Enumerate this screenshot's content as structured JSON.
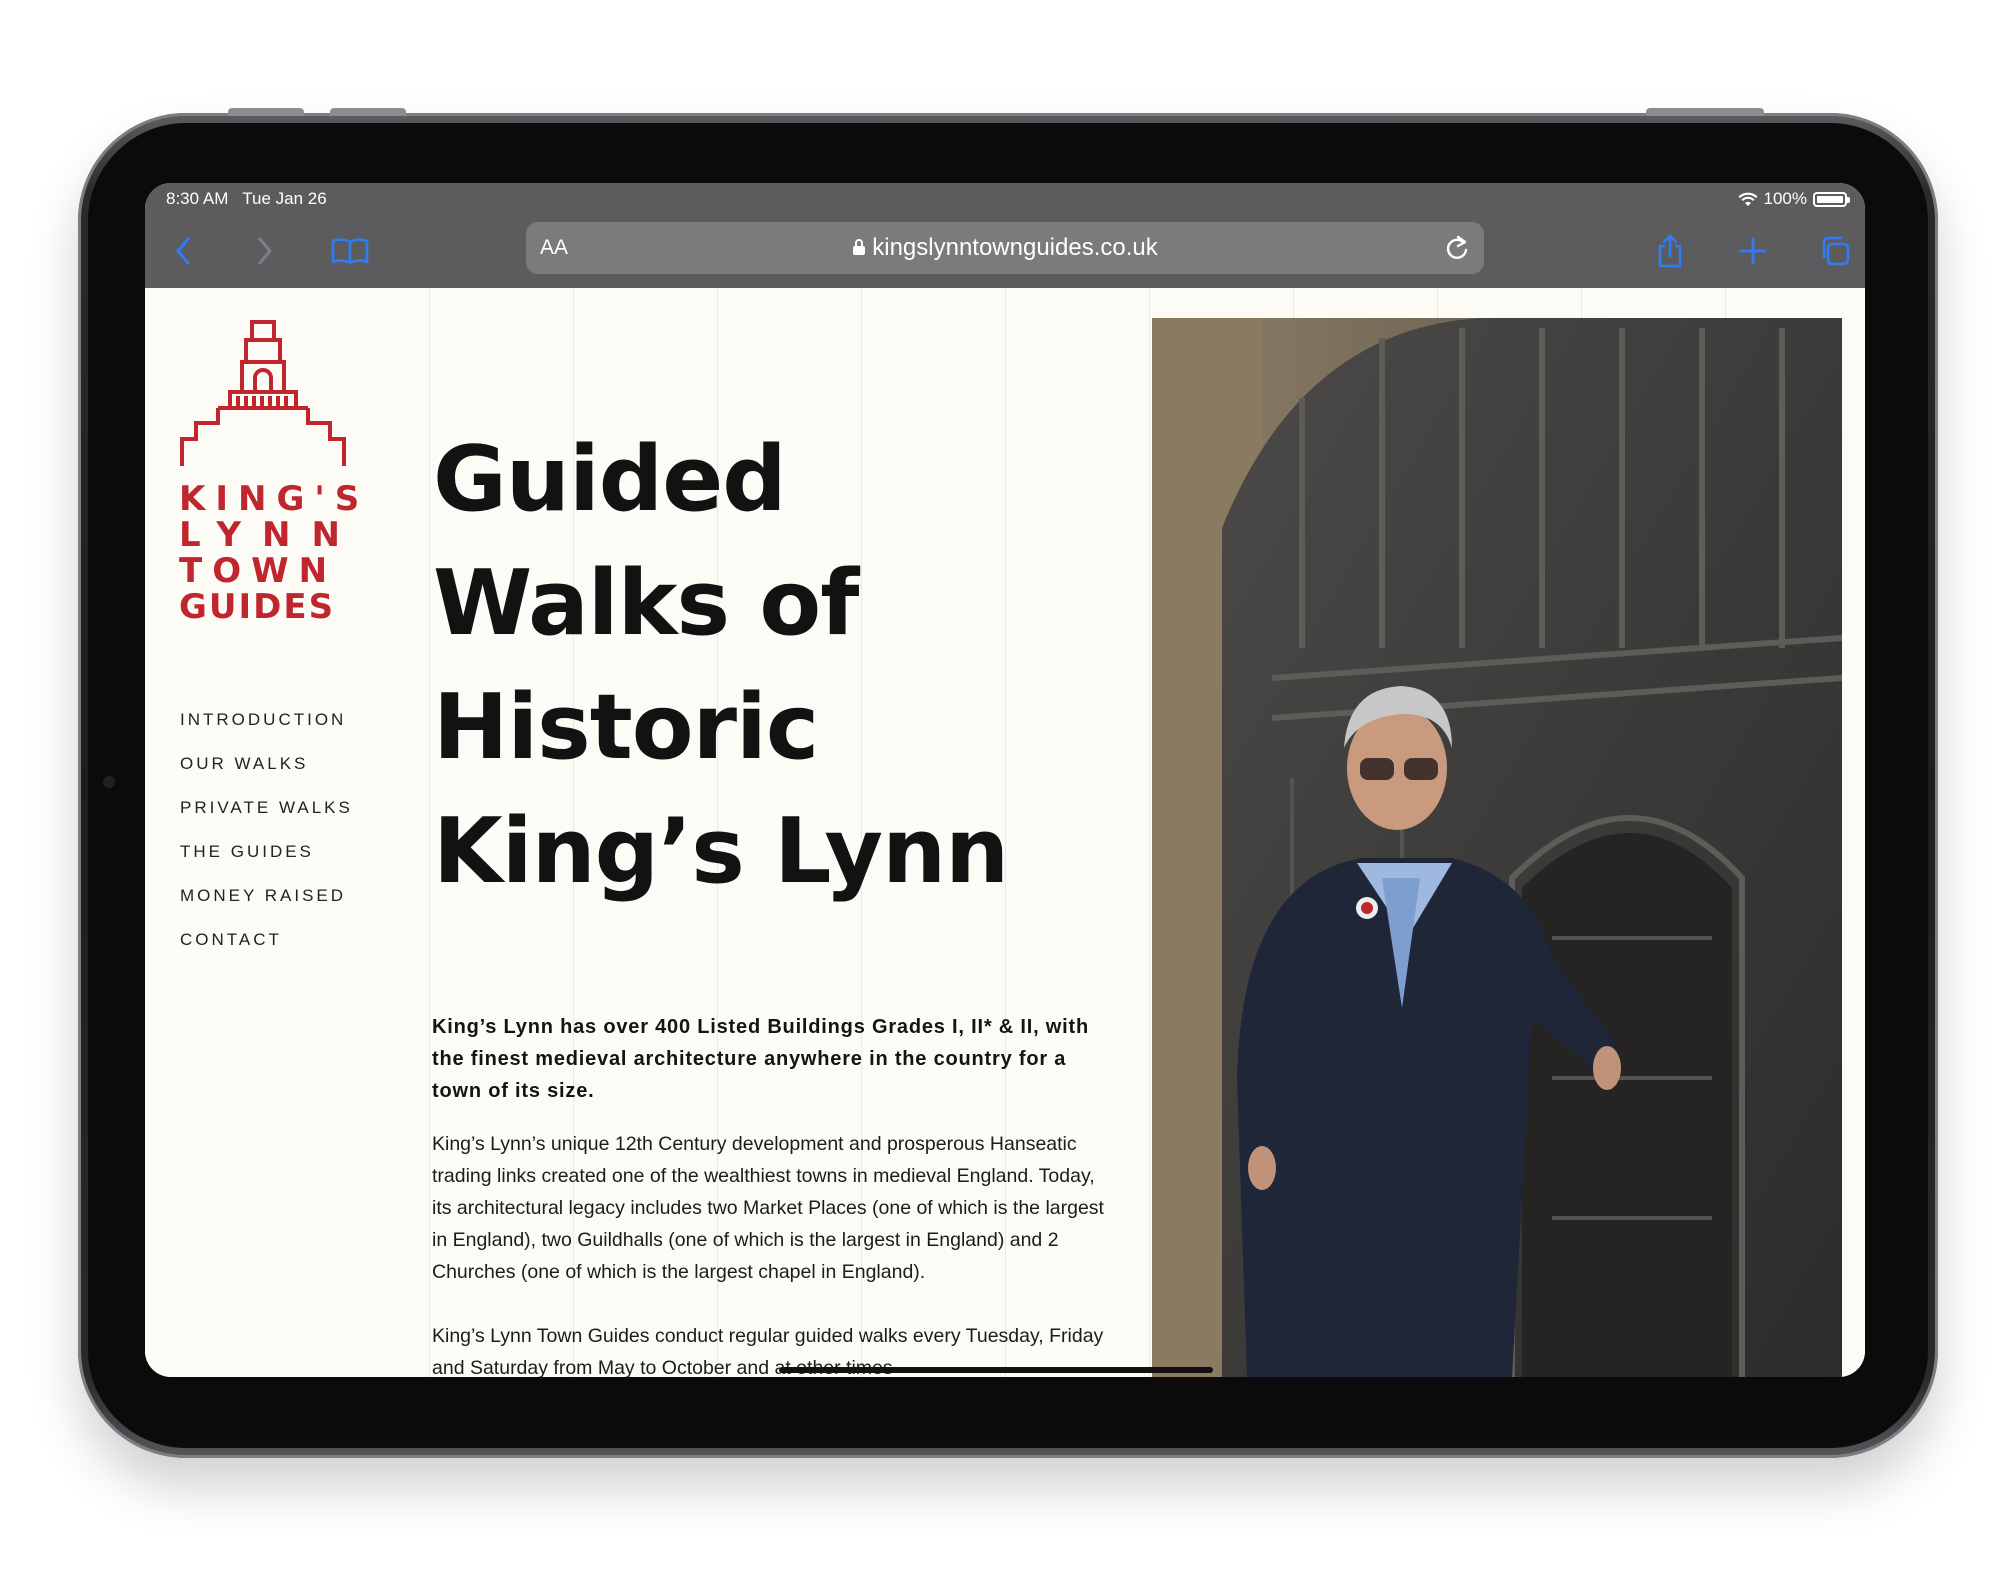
{
  "status": {
    "time": "8:30 AM",
    "date": "Tue Jan 26",
    "battery": "100%"
  },
  "toolbar": {
    "reader_label": "AA",
    "url": "kingslynntownguides.co.uk",
    "icons": [
      "chevron-left-icon",
      "chevron-right-icon",
      "book-icon",
      "lock-icon",
      "reload-icon",
      "share-icon",
      "plus-icon",
      "tabs-icon"
    ]
  },
  "logo": {
    "line1": "KING'S",
    "line2": "LYNN",
    "line3": "TOWN",
    "line4": "GUIDES",
    "color": "#c0262d"
  },
  "nav": [
    "INTRODUCTION",
    "OUR WALKS",
    "PRIVATE WALKS",
    "THE GUIDES",
    "MONEY RAISED",
    "CONTACT"
  ],
  "hero": {
    "title_lines": [
      "Guided",
      "Walks of",
      "Historic",
      "King’s Lynn"
    ]
  },
  "body": {
    "intro": "King’s Lynn has over 400 Listed Buildings Grades I, II* & II, with the finest medieval architecture anywhere in the country for a town of its size.",
    "para1": "King’s Lynn’s unique 12th Century development and prosperous Hanseatic trading links created one of the wealthiest towns in medieval England. Today, its architectural legacy includes two Market Places (one of which is the largest in England), two Guildhalls (one of which is the largest in England) and 2 Churches (one of which is the largest chapel in England).",
    "para2": "King’s Lynn Town Guides conduct regular guided walks every Tuesday, Friday and Saturday from May to October and at other times"
  },
  "colors": {
    "accent": "#c0262d",
    "chrome": "#5c5c5e",
    "link_blue": "#2f7cf6"
  }
}
